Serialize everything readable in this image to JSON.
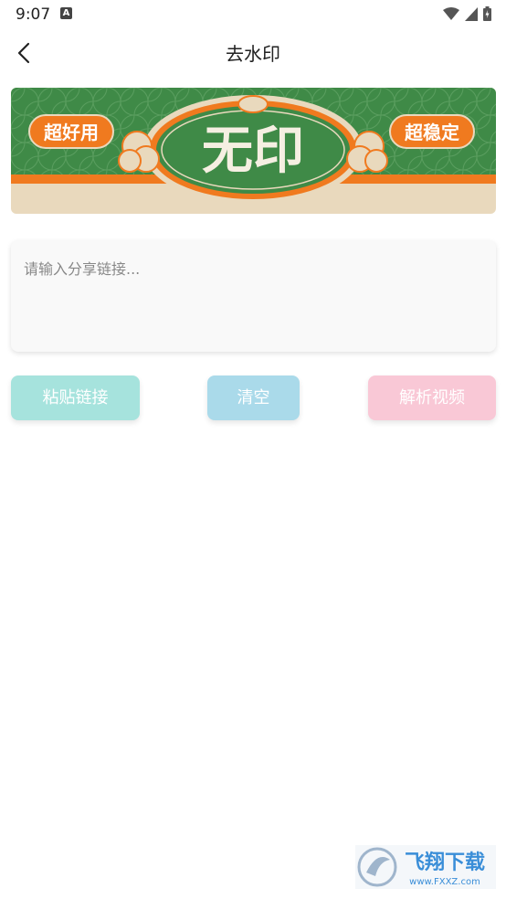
{
  "status_bar": {
    "time": "9:07",
    "notification_icon_letter": "A",
    "icons": [
      "wifi-icon",
      "signal-icon",
      "battery-icon"
    ]
  },
  "app_bar": {
    "title": "去水印",
    "back_icon": "chevron-left-icon"
  },
  "banner": {
    "left_tag": "超好用",
    "center_text": "无印",
    "right_tag": "超稳定",
    "colors": {
      "green": "#3f8a47",
      "orange": "#f07a1f",
      "cream": "#e9d9bd"
    }
  },
  "link_input": {
    "placeholder": "请输入分享链接...",
    "value": ""
  },
  "buttons": {
    "paste": "粘贴链接",
    "clear": "清空",
    "parse": "解析视频"
  },
  "watermark": {
    "brand": "飞翔下载",
    "url": "www.FXXZ.com"
  }
}
